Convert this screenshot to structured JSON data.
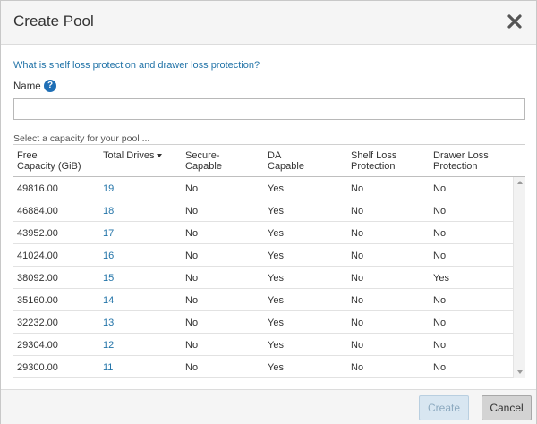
{
  "dialog": {
    "title": "Create Pool",
    "help_link": "What is shelf loss protection and drawer loss protection?",
    "name_label": "Name",
    "name_value": "",
    "name_placeholder": "",
    "select_caption": "Select a capacity for your pool ...",
    "create_label": "Create",
    "cancel_label": "Cancel",
    "close_icon": "close-icon",
    "help_icon": "question-circle-icon",
    "colors": {
      "link": "#2374a8",
      "help_icon": "#1f6fb6",
      "create_disabled_bg": "#d8e6f1",
      "cancel_bg": "#d3d3d3"
    }
  },
  "table": {
    "headers": {
      "capacity": [
        "Free",
        "Capacity (GiB)"
      ],
      "drives": "Total Drives",
      "secure": [
        "Secure-",
        "Capable"
      ],
      "da": [
        "DA",
        "Capable"
      ],
      "shelf": [
        "Shelf Loss",
        "Protection"
      ],
      "drawer": [
        "Drawer Loss",
        "Protection"
      ]
    },
    "sort": {
      "column": "Total Drives",
      "direction": "descending"
    },
    "rows": [
      {
        "capacity": "49816.00",
        "drives": "19",
        "secure": "No",
        "da": "Yes",
        "shelf": "No",
        "drawer": "No"
      },
      {
        "capacity": "46884.00",
        "drives": "18",
        "secure": "No",
        "da": "Yes",
        "shelf": "No",
        "drawer": "No"
      },
      {
        "capacity": "43952.00",
        "drives": "17",
        "secure": "No",
        "da": "Yes",
        "shelf": "No",
        "drawer": "No"
      },
      {
        "capacity": "41024.00",
        "drives": "16",
        "secure": "No",
        "da": "Yes",
        "shelf": "No",
        "drawer": "No"
      },
      {
        "capacity": "38092.00",
        "drives": "15",
        "secure": "No",
        "da": "Yes",
        "shelf": "No",
        "drawer": "Yes"
      },
      {
        "capacity": "35160.00",
        "drives": "14",
        "secure": "No",
        "da": "Yes",
        "shelf": "No",
        "drawer": "No"
      },
      {
        "capacity": "32232.00",
        "drives": "13",
        "secure": "No",
        "da": "Yes",
        "shelf": "No",
        "drawer": "No"
      },
      {
        "capacity": "29304.00",
        "drives": "12",
        "secure": "No",
        "da": "Yes",
        "shelf": "No",
        "drawer": "No"
      },
      {
        "capacity": "29300.00",
        "drives": "11",
        "secure": "No",
        "da": "Yes",
        "shelf": "No",
        "drawer": "No"
      }
    ]
  }
}
